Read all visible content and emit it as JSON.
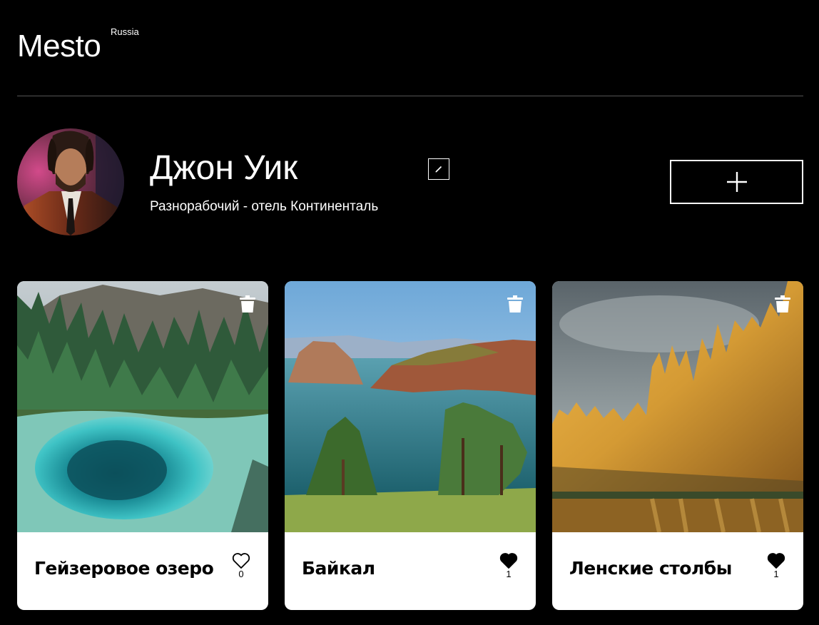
{
  "header": {
    "logo": "Mesto",
    "logo_sup": "Russia"
  },
  "profile": {
    "name": "Джон Уик",
    "about": "Разнорабочий - отель Континенталь",
    "add_button": "+"
  },
  "cards": [
    {
      "title": "Гейзеровое озеро",
      "likes": "0",
      "liked": false
    },
    {
      "title": "Байкал",
      "likes": "1",
      "liked": true
    },
    {
      "title": "Ленские столбы",
      "likes": "1",
      "liked": true
    }
  ],
  "colors": {
    "background": "#000000",
    "card": "#ffffff",
    "divider": "#545454"
  }
}
